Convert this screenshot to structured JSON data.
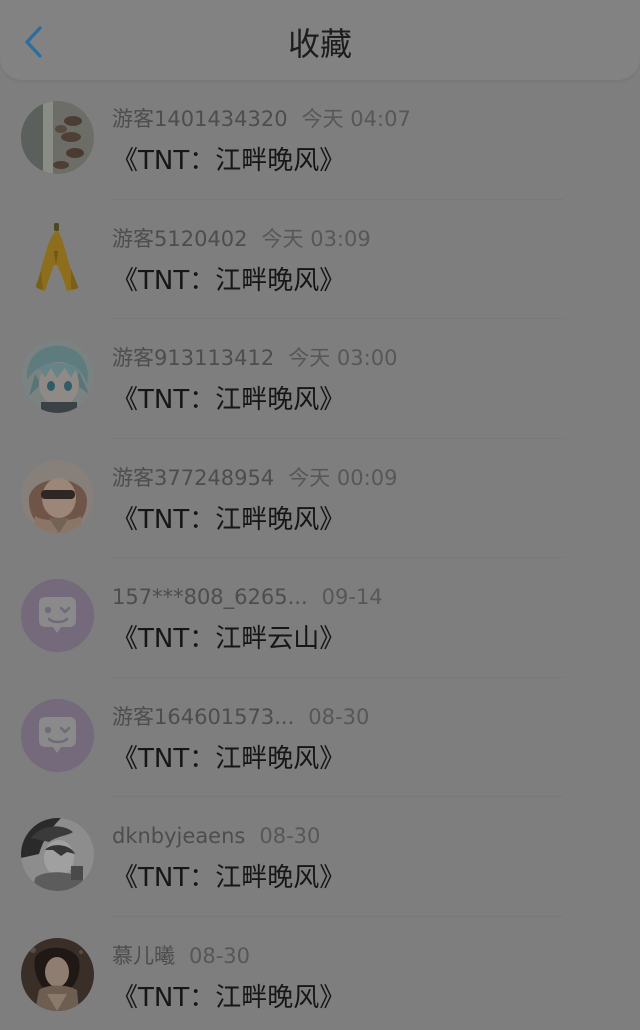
{
  "header": {
    "title": "收藏",
    "back_icon": "chevron-left-icon",
    "accent_color": "#2b6d9f"
  },
  "items": [
    {
      "user": "游客1401434320",
      "time": "今天 04:07",
      "title": "《TNT：江畔晚风》",
      "avatar": "photo-avatar"
    },
    {
      "user": "游客5120402",
      "time": "今天 03:09",
      "title": "《TNT：江畔晚风》",
      "avatar": "banana-avatar"
    },
    {
      "user": "游客913113412",
      "time": "今天 03:00",
      "title": "《TNT：江畔晚风》",
      "avatar": "anime-avatar"
    },
    {
      "user": "游客377248954",
      "time": "今天 00:09",
      "title": "《TNT：江畔晚风》",
      "avatar": "photo-avatar"
    },
    {
      "user": "157***808_6265...",
      "time": "09-14",
      "title": "《TNT：江畔云山》",
      "avatar": "default-chat-avatar"
    },
    {
      "user": "游客164601573...",
      "time": "08-30",
      "title": "《TNT：江畔晚风》",
      "avatar": "default-chat-avatar"
    },
    {
      "user": "dknbyjeaens",
      "time": "08-30",
      "title": "《TNT：江畔晚风》",
      "avatar": "photo-avatar"
    },
    {
      "user": "慕儿曦",
      "time": "08-30",
      "title": "《TNT：江畔晚风》",
      "avatar": "photo-avatar"
    }
  ]
}
